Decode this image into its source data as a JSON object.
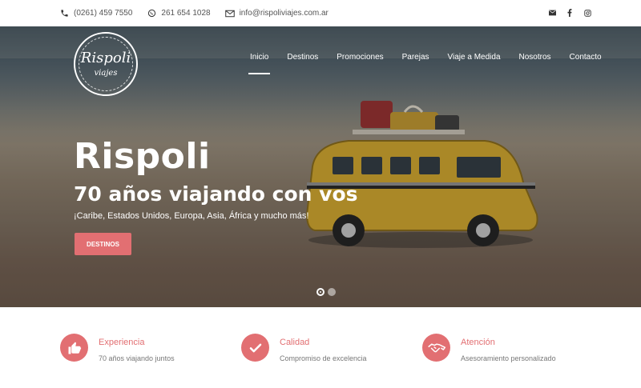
{
  "topbar": {
    "phone": "(0261) 459 7550",
    "whatsapp": "261 654 1028",
    "email": "info@rispoliviajes.com.ar",
    "social_icons": [
      "email-icon",
      "facebook-icon",
      "instagram-icon"
    ]
  },
  "logo": {
    "line1": "Rispoli",
    "line2": "viajes"
  },
  "nav": [
    {
      "label": "Inicio",
      "active": true
    },
    {
      "label": "Destinos"
    },
    {
      "label": "Promociones"
    },
    {
      "label": "Parejas"
    },
    {
      "label": "Viaje a Medida"
    },
    {
      "label": "Nosotros"
    },
    {
      "label": "Contacto"
    }
  ],
  "hero": {
    "title": "Rispoli",
    "subtitle": "70 años viajando con vos",
    "tagline": "¡Caribe, Estados Unidos, Europa, Asia, África y mucho más!",
    "cta": "DESTINOS",
    "slide_active": 1,
    "slide_count": 2
  },
  "features": [
    {
      "title": "Experiencia",
      "desc": "70 años viajando juntos",
      "icon": "thumbs-up-icon"
    },
    {
      "title": "Calidad",
      "desc": "Compromiso de excelencia",
      "icon": "checkmark-icon"
    },
    {
      "title": "Atención",
      "desc": "Asesoramiento personalizado",
      "icon": "handshake-icon"
    }
  ],
  "colors": {
    "accent": "#e26f72",
    "text_muted": "#777777"
  }
}
